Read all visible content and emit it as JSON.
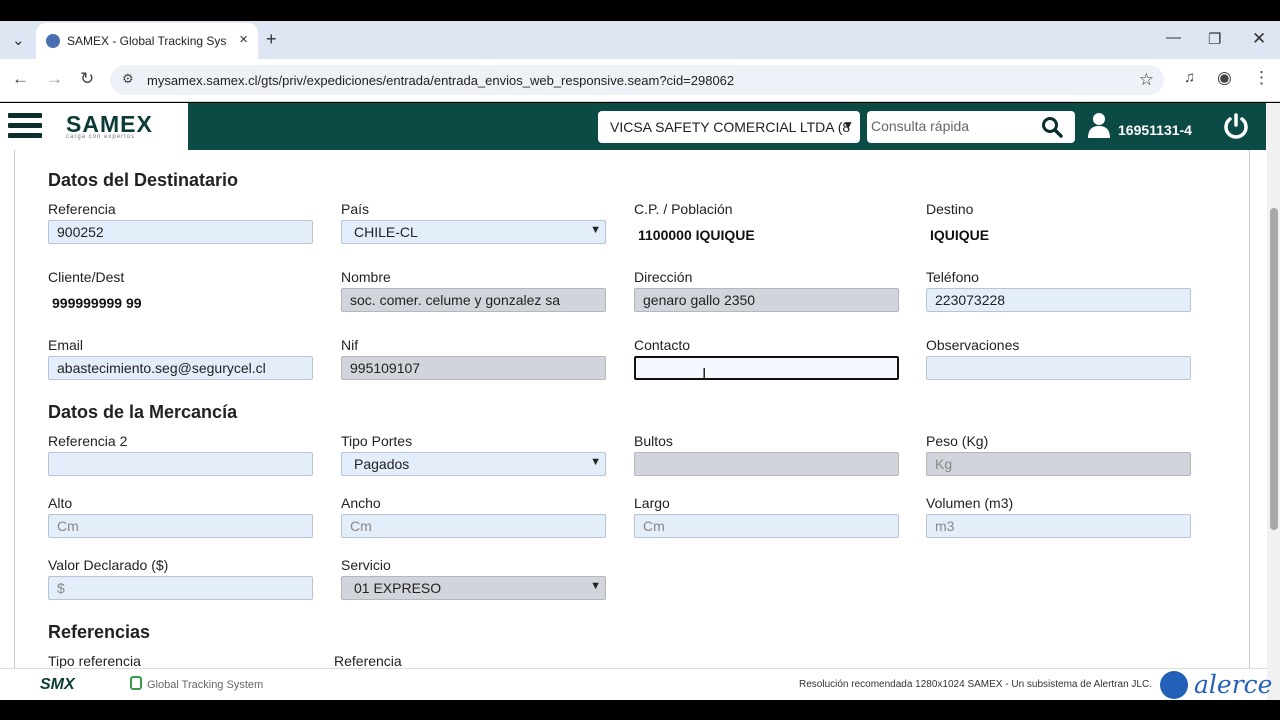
{
  "browser": {
    "tab_title": "SAMEX - Global Tracking System",
    "url": "mysamex.samex.cl/gts/priv/expediciones/entrada/entrada_envios_web_responsive.seam?cid=298062"
  },
  "header": {
    "logo": "SAMEX",
    "logo_sub": "carga con expertos",
    "company": "VICSA SAFETY COMERCIAL LTDA (8",
    "search_placeholder": "Consulta rápida",
    "user_id": "16951131-4"
  },
  "destinatario": {
    "title": "Datos del Destinatario",
    "referencia": {
      "label": "Referencia",
      "value": "900252"
    },
    "pais": {
      "label": "País",
      "value": "CHILE-CL"
    },
    "cp": {
      "label": "C.P. / Población",
      "value": "1100000 IQUIQUE"
    },
    "destino": {
      "label": "Destino",
      "value": "IQUIQUE"
    },
    "cliente": {
      "label": "Cliente/Dest",
      "value": "999999999 99"
    },
    "nombre": {
      "label": "Nombre",
      "value": "soc. comer. celume y gonzalez sa"
    },
    "direccion": {
      "label": "Dirección",
      "value": "genaro gallo 2350"
    },
    "telefono": {
      "label": "Teléfono",
      "value": "223073228"
    },
    "email": {
      "label": "Email",
      "value": "abastecimiento.seg@segurycel.cl"
    },
    "nif": {
      "label": "Nif",
      "value": "995109107"
    },
    "contacto": {
      "label": "Contacto",
      "value": ""
    },
    "observaciones": {
      "label": "Observaciones",
      "value": ""
    }
  },
  "mercancia": {
    "title": "Datos de la Mercancía",
    "referencia2": {
      "label": "Referencia 2",
      "value": ""
    },
    "tipo_portes": {
      "label": "Tipo Portes",
      "value": "Pagados"
    },
    "bultos": {
      "label": "Bultos",
      "value": ""
    },
    "peso": {
      "label": "Peso (Kg)",
      "placeholder": "Kg"
    },
    "alto": {
      "label": "Alto",
      "placeholder": "Cm"
    },
    "ancho": {
      "label": "Ancho",
      "placeholder": "Cm"
    },
    "largo": {
      "label": "Largo",
      "placeholder": "Cm"
    },
    "volumen": {
      "label": "Volumen (m3)",
      "placeholder": "m3"
    },
    "valor": {
      "label": "Valor Declarado ($)",
      "placeholder": "$"
    },
    "servicio": {
      "label": "Servicio",
      "value": "01 EXPRESO"
    }
  },
  "referencias": {
    "title": "Referencias",
    "col_tipo": "Tipo referencia",
    "col_ref": "Referencia"
  },
  "footer": {
    "smx": "SMX",
    "gts": "Global Tracking System",
    "resolution": "Resolución recomendada 1280x1024   SAMEX - Un subsistema de Alertran JLC.",
    "alerce": "alerce"
  }
}
